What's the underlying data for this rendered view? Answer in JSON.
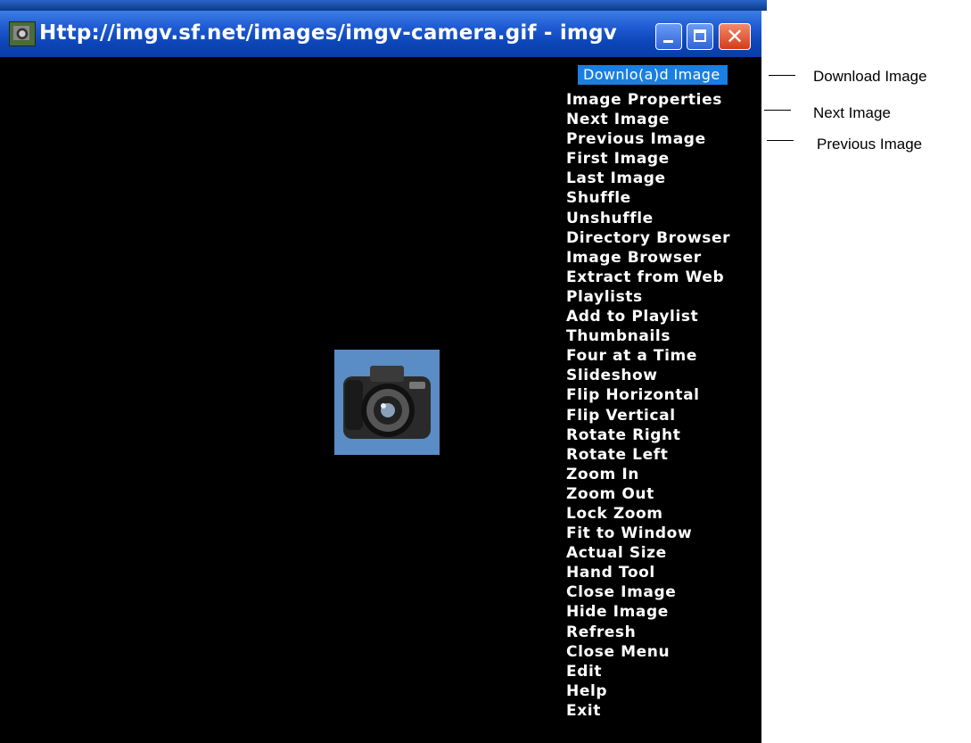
{
  "window": {
    "title": "Http://imgv.sf.net/images/imgv-camera.gif - imgv",
    "minimize_glyph": "",
    "maximize_glyph": "",
    "close_glyph": "✕"
  },
  "menu": {
    "selected": "Downlo(a)d Image",
    "items": [
      "Image Properties",
      "Next Image",
      "Previous Image",
      "First Image",
      "Last Image",
      "Shuffle",
      "Unshuffle",
      "Directory Browser",
      "Image Browser",
      "Extract from Web",
      "Playlists",
      "Add to Playlist",
      "Thumbnails",
      "Four at a Time",
      "Slideshow",
      "Flip Horizontal",
      "Flip Vertical",
      "Rotate Right",
      "Rotate Left",
      "Zoom In",
      "Zoom Out",
      "Lock Zoom",
      "Fit to Window",
      "Actual Size",
      "Hand Tool",
      "Close Image",
      "Hide Image",
      "Refresh",
      "Close Menu",
      "Edit",
      "Help",
      "Exit"
    ]
  },
  "callouts": {
    "download": "Download Image",
    "next": "Next Image",
    "previous": "Previous Image"
  },
  "colors": {
    "titlebar": "#0c45b8",
    "highlight": "#1a7fe0",
    "background": "#000000",
    "image_bg": "#5a8cc5"
  },
  "icons": [
    "app-icon",
    "minimize-icon",
    "maximize-icon",
    "close-icon",
    "camera-image"
  ]
}
